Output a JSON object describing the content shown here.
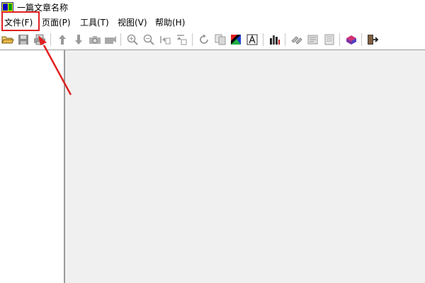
{
  "window": {
    "title": "一篇文章名称"
  },
  "menu": {
    "file": "文件(F)",
    "page": "页面(P)",
    "tools": "工具(T)",
    "view": "视图(V)",
    "help": "帮助(H)"
  },
  "toolbar": {
    "icons": [
      "open-folder-icon",
      "save-icon",
      "print-icon",
      "arrow-up-icon",
      "arrow-down-icon",
      "camera-icon",
      "scan-icon",
      "zoom-in-icon",
      "zoom-out-icon",
      "fit-width-icon",
      "fit-height-icon",
      "rotate-icon",
      "copy-icon",
      "color-icon",
      "text-icon",
      "chart-icon",
      "link-icon",
      "note-icon",
      "page-icon",
      "book-icon",
      "exit-icon"
    ]
  },
  "colors": {
    "annotation": "#e02020",
    "workspace": "#f0f0f0"
  }
}
